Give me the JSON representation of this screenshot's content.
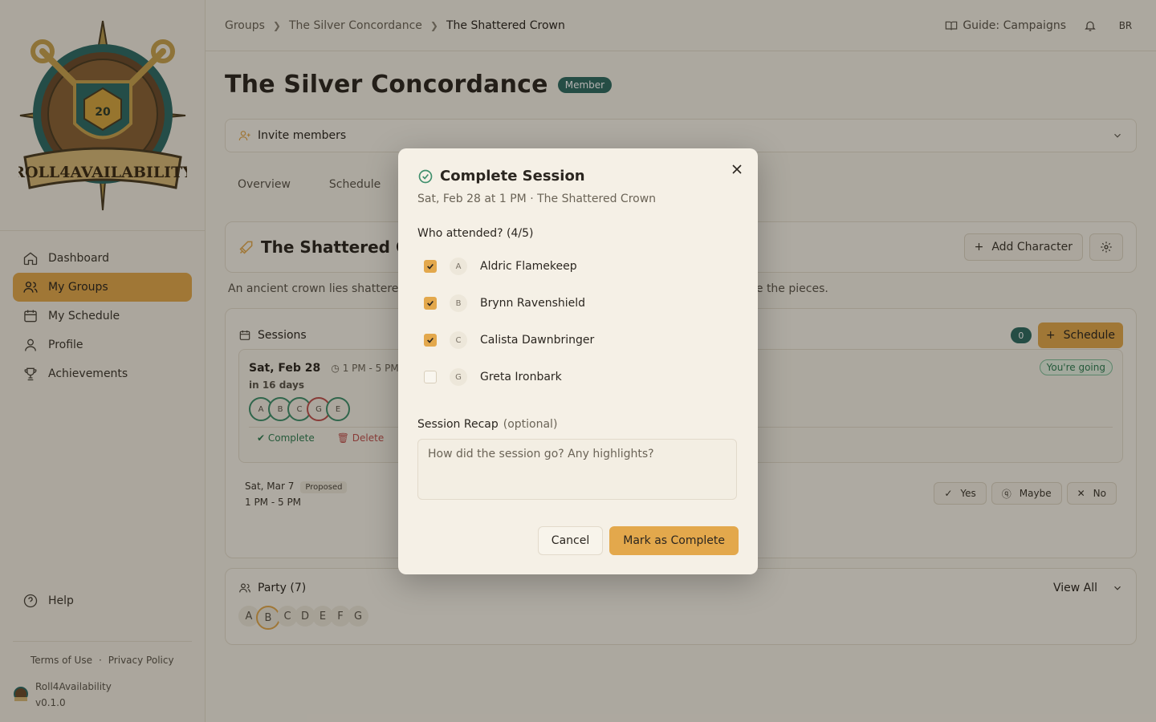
{
  "app": {
    "name": "Roll4Availability",
    "version": "v0.1.0"
  },
  "sidebar": {
    "items": [
      {
        "label": "Dashboard",
        "icon": "home-icon"
      },
      {
        "label": "My Groups",
        "icon": "users-icon",
        "active": true
      },
      {
        "label": "My Schedule",
        "icon": "calendar-icon"
      },
      {
        "label": "Profile",
        "icon": "user-icon"
      },
      {
        "label": "Achievements",
        "icon": "trophy-icon"
      }
    ],
    "help": "Help",
    "terms": "Terms of Use",
    "legal_sep": "·",
    "privacy": "Privacy Policy"
  },
  "topbar": {
    "breadcrumbs": [
      "Groups",
      "The Silver Concordance",
      "The Shattered Crown"
    ],
    "guide": "Guide: Campaigns",
    "user_initials": "BR"
  },
  "group": {
    "name": "The Silver Concordance",
    "role_badge": "Member",
    "invite": "Invite members",
    "tabs": [
      "Overview",
      "Schedule"
    ]
  },
  "campaign": {
    "title": "The Shattered Crown",
    "description_left": "An ancient crown lies shattere",
    "description_right": "te the pieces.",
    "add_character": "Add Character"
  },
  "sessions": {
    "title": "Sessions",
    "count": "0",
    "schedule_button": "Schedule",
    "upcoming": {
      "date": "Sat, Feb 28",
      "time": "1 PM - 5 PM",
      "relative": "in 16 days",
      "attendees": [
        "A",
        "B",
        "C",
        "G",
        "E"
      ],
      "complete": "Complete",
      "delete": "Delete",
      "status": "You're going"
    },
    "proposed": {
      "date": "Sat, Mar 7",
      "badge": "Proposed",
      "time": "1 PM - 5 PM",
      "yes": "Yes",
      "maybe": "Maybe",
      "no": "No"
    }
  },
  "party": {
    "title": "Party (7)",
    "view_all": "View All",
    "members": [
      "A",
      "B",
      "C",
      "D",
      "E",
      "F",
      "G"
    ]
  },
  "modal": {
    "title": "Complete Session",
    "subtitle": "Sat, Feb 28 at 1 PM · The Shattered Crown",
    "attended_label": "Who attended? (4/5)",
    "attendees": [
      {
        "initial": "A",
        "name": "Aldric Flamekeep",
        "checked": true
      },
      {
        "initial": "B",
        "name": "Brynn Ravenshield",
        "checked": true
      },
      {
        "initial": "C",
        "name": "Calista Dawnbringer",
        "checked": true
      },
      {
        "initial": "G",
        "name": "Greta Ironbark",
        "checked": false
      }
    ],
    "recap_label": "Session Recap",
    "recap_optional": "(optional)",
    "recap_placeholder": "How did the session go? Any highlights?",
    "cancel": "Cancel",
    "confirm": "Mark as Complete"
  },
  "colors": {
    "accent": "#e3a84c",
    "teal": "#2f6a62",
    "success": "#3f8f6c",
    "danger": "#c0504d"
  }
}
